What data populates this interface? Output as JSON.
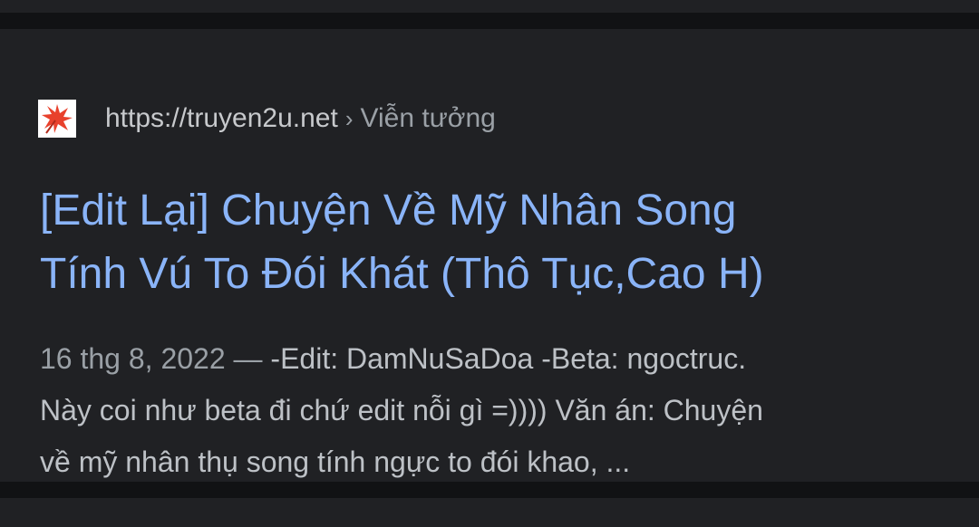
{
  "result": {
    "site": {
      "favicon_icon": "red-maple-leaf-icon",
      "url": "https://truyen2u.net",
      "separator": "›",
      "category": "Viễn tưởng"
    },
    "title_lines": [
      "[Edit Lại] Chuyện Về Mỹ Nhân Song",
      "Tính Vú To Đói Khát (Thô Tục,Cao H)"
    ],
    "snippet": {
      "date": "16 thg 8, 2022",
      "dash": " — ",
      "line1_rest": "-Edit: DamNuSaDoa -Beta: ngoctruc.",
      "line2": "Này coi như beta đi chứ edit nỗi gì =)))) Văn án: Chuyện",
      "line3": "về mỹ nhân thụ song tính ngực to đói khao, ..."
    }
  },
  "colors": {
    "title_link": "#8ab4f8",
    "card_bg": "#202124",
    "separator_bg": "#111214",
    "favicon_accent": "#e8412c"
  }
}
